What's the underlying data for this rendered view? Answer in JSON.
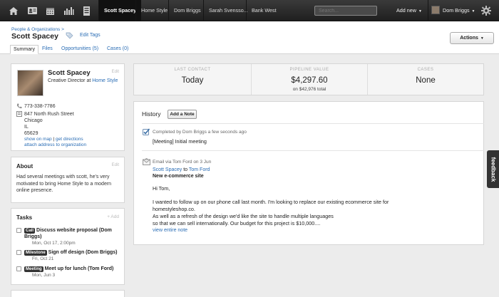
{
  "nav": {
    "icons": [
      "home-icon",
      "contacts-icon",
      "calendar-icon",
      "reports-icon",
      "cases-icon"
    ],
    "tabs": [
      "Scott Spacey",
      "Home Style",
      "Dom Briggs",
      "Sarah Svensso...",
      "Bank West"
    ],
    "search_placeholder": "Search...",
    "add_new": "Add new",
    "user_name": "Dom Briggs"
  },
  "header": {
    "breadcrumb": "People & Organizations >",
    "title": "Scott Spacey",
    "edit_tags": "Edit Tags",
    "actions": "Actions",
    "tabs": [
      "Summary",
      "Files",
      "Opportunities (5)",
      "Cases (0)"
    ]
  },
  "profile": {
    "name": "Scott Spacey",
    "role_prefix": "Creative Director at",
    "org": "Home Style",
    "edit": "Edit",
    "phone": "773-338-7786",
    "address_lines": [
      "847 North Rush Street",
      "Chicago",
      "IL",
      "65629"
    ],
    "show_on_map": "show on map",
    "get_directions": "get directions",
    "attach_address": "attach address to organization"
  },
  "about": {
    "title": "About",
    "edit": "Edit",
    "text": "Had several meetings with scott, he's very motivated to bring Home Style to a modern online presence."
  },
  "tasks": {
    "title": "Tasks",
    "add": "+ Add",
    "items": [
      {
        "badge": "Call",
        "text": "Discuss website proposal (Dom Briggs)",
        "date": "Mon, Oct 17, 2:00pm"
      },
      {
        "badge": "Milestone",
        "text": "Sign off design (Dom Briggs)",
        "date": "Fri, Oct 21"
      },
      {
        "badge": "Meeting",
        "text": "Meet up for lunch (Tom Ford)",
        "date": "Mon, Jun 3"
      }
    ]
  },
  "stats": [
    {
      "label": "LAST CONTACT",
      "value": "Today",
      "sub": ""
    },
    {
      "label": "PIPELINE VALUE",
      "value": "$4,297.60",
      "sub": "on $42,976 total"
    },
    {
      "label": "CASES",
      "value": "None",
      "sub": ""
    }
  ],
  "history": {
    "title": "History",
    "add_note": "Add a Note",
    "entries": [
      {
        "meta": "Completed by Dom Briggs a few seconds ago",
        "text": "[Meeting] Initial meeting"
      },
      {
        "meta": "Email via Tom Ford on 3 Jun",
        "from": "Scott Spacey",
        "to_word": "to",
        "to": "Tom Ford",
        "subject": "New e-commerce site",
        "greeting": "Hi Tom,",
        "body": [
          "I wanted to follow up on our phone call last month. I'm looking to replace our existing ecommerce site for",
          "homestyleshop.co.",
          "As well as a refresh of the design we'd like the site to handle multiple languages",
          "so that we can sell internationally. Our budget for this project is $10,000...."
        ],
        "view_note": "view entire note"
      }
    ]
  },
  "feedback": "feedback"
}
